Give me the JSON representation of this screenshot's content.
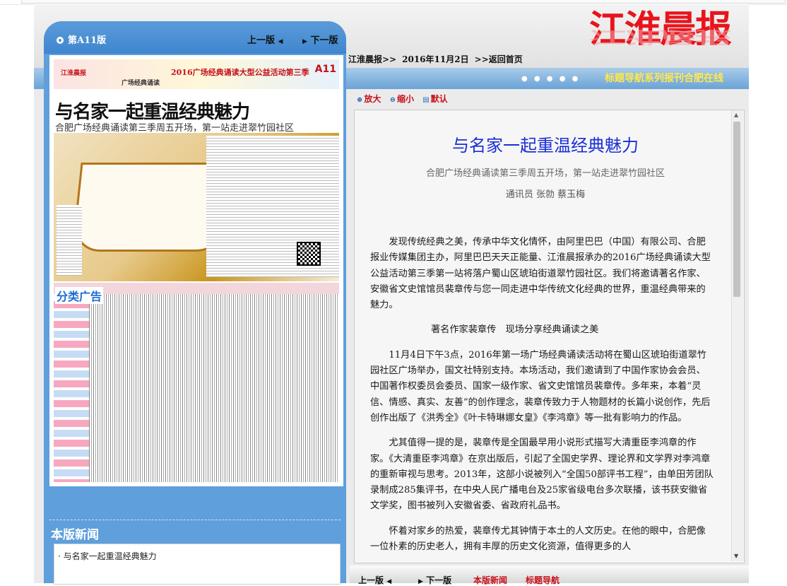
{
  "masthead": {
    "name": "江淮晨报",
    "slogan": "标题导航系列报刊合肥在线",
    "dots": "● ● ● ● ●"
  },
  "breadcrumb": {
    "paper": "江淮晨报>>",
    "date": "2016年11月2日",
    "home": ">>返回首页"
  },
  "left_panel": {
    "page_label": "第A11版",
    "prev_label": "上一版",
    "prev_arrow": "◀",
    "next_arrow": "▶",
    "next_label": "下一版",
    "newspaper_page": {
      "brand": "江淮晨报",
      "section_banner": "2016广场经典诵读大型公益活动第三季",
      "section_name": "广场经典诵读",
      "page_code": "A11",
      "headline": "与名家一起重温经典魅力",
      "subheadline": "合肥广场经典诵读第三季周五开场，第一站走进翠竹园社区",
      "ad_section_label": "分类广告"
    },
    "news_heading": "本版新闻",
    "news_items": [
      "与名家一起重温经典魅力"
    ]
  },
  "toolbar": {
    "zoom_in": "放大",
    "zoom_out": "缩小",
    "default": "默认"
  },
  "article": {
    "title": "与名家一起重温经典魅力",
    "subtitle": "合肥广场经典诵读第三季周五开场，第一站走进翠竹园社区",
    "authors": "通讯员 张勍 蔡玉梅",
    "paragraphs": [
      "发现传统经典之美，传承中华文化情怀，由阿里巴巴（中国）有限公司、合肥报业传媒集团主办，阿里巴巴天天正能量、江淮晨报承办的2016广场经典诵读大型公益活动第三季第一站将落户蜀山区琥珀街道翠竹园社区。我们将邀请著名作家、安徽省文史馆馆员裴章传与您一同走进中华传统文化经典的世界，重温经典带来的魅力。",
      "著名作家裴章传　现场分享经典诵读之美",
      "11月4日下午3点，2016年第一场广场经典诵读活动将在蜀山区琥珀街道翠竹园社区广场举办，国文社特别支持。本场活动，我们邀请到了中国作家协会会员、中国著作权委员会委员、国家一级作家、省文史馆馆员裴章传。多年来，本着“灵信、情感、真实、友善”的创作理念，裴章传致力于人物题材的长篇小说创作，先后创作出版了《洪秀全》《叶卡特琳娜女皇》《李鸿章》等一批有影响力的作品。",
      "尤其值得一提的是，裴章传是全国最早用小说形式描写大清重臣李鸿章的作家。《大清重臣李鸿章》在京出版后，引起了全国史学界、理论界和文学界对李鸿章的重新审视与思考。2013年，这部小说被列入“全国50部评书工程”，由单田芳团队录制成285集评书，在中央人民广播电台及25家省级电台多次联播，该书获安徽省文学奖，图书被列入安徽省委、省政府礼品书。",
      "怀着对家乡的热爱，裴章传尤其钟情于本土的人文历史。在他的眼中，合肥像一位朴素的历史老人，拥有丰厚的历史文化资源，值得更多的人"
    ]
  },
  "bottom_nav": {
    "prev": "上一版",
    "next": "下一版",
    "news": "本版新闻",
    "nav": "标题导航"
  },
  "colors": {
    "accent_blue": "#4a8fd4",
    "brand_red": "#e8141c",
    "title_blue": "#1a2fd6",
    "slogan_yellow": "#ffe84a"
  }
}
